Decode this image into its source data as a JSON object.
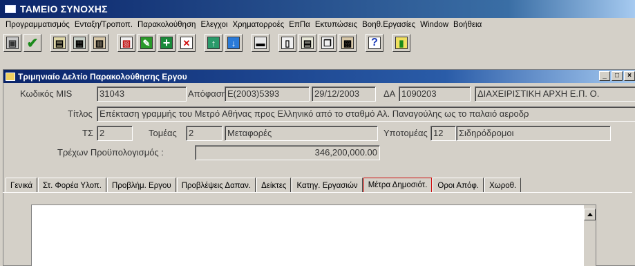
{
  "app": {
    "title": "ΤΑΜΕΙΟ ΣΥΝΟΧΗΣ"
  },
  "menu": [
    "Προγραμματισμός",
    "Ενταξη/Τροποπ.",
    "Παρακολούθηση",
    "Ελεγχοι",
    "Χρηματορροές",
    "ΕπΠα",
    "Εκτυπώσεις",
    "Βοηθ.Εργασίες",
    "Window",
    "Βοήθεια"
  ],
  "toolbar": {
    "buttons": [
      {
        "name": "save-icon",
        "glyph": "▣"
      },
      {
        "name": "check-icon",
        "glyph": "✔"
      },
      {
        "name": "dialog-icon",
        "glyph": "▤"
      },
      {
        "name": "grid-icon",
        "glyph": "▦"
      },
      {
        "name": "document-icon",
        "glyph": "▥"
      },
      {
        "name": "chart-icon",
        "glyph": "▧"
      },
      {
        "name": "edit-icon",
        "glyph": "✎"
      },
      {
        "name": "add-row-icon",
        "glyph": "+"
      },
      {
        "name": "delete-icon",
        "glyph": "✕"
      },
      {
        "name": "arrow-up-icon",
        "glyph": "↑"
      },
      {
        "name": "arrow-down-icon",
        "glyph": "↓"
      },
      {
        "name": "print-icon",
        "glyph": "▬"
      },
      {
        "name": "columns-icon",
        "glyph": "▯"
      },
      {
        "name": "report-icon",
        "glyph": "▤"
      },
      {
        "name": "copy-icon",
        "glyph": "❐"
      },
      {
        "name": "paste-icon",
        "glyph": "▩"
      },
      {
        "name": "help-icon",
        "glyph": "?"
      },
      {
        "name": "exit-icon",
        "glyph": "▮"
      }
    ]
  },
  "child": {
    "title": "Τριμηνιαίο Δελτίο Παρακολούθησης Εργου",
    "win_min": "_",
    "win_restore": "□",
    "win_close": "×",
    "labels": {
      "mis": "Κωδικός MIS",
      "decision": "Απόφαση",
      "da": "ΔΑ",
      "title": "Τίτλος",
      "ts": "ΤΣ",
      "sector": "Τομέας",
      "subsector": "Υποτομέας",
      "budget": "Τρέχων Προϋπολογισμός :"
    },
    "values": {
      "mis": "31043",
      "decision": "E(2003)5393",
      "decision_date": "29/12/2003",
      "da_code": "1090203",
      "authority": "ΔΙΑΧΕΙΡΙΣΤΙΚΗ ΑΡΧΗ Ε.Π. Ο.",
      "title": "Επέκταση γραμμής του Μετρό Αθήνας προς Ελληνικό από το σταθμό Αλ. Παναγούλης ως το παλαιό αεροδρ",
      "ts": "2",
      "sector_code": "2",
      "sector_name": "Μεταφορές",
      "subsector_code": "12",
      "subsector_name": "Σιδηρόδρομοι",
      "budget": "346,200,000.00"
    }
  },
  "tabs": [
    "Γενικά",
    "Στ. Φορέα Υλοπ.",
    "Προβλήμ. Εργου",
    "Προβλέψεις Δαπαν.",
    "Δείκτες",
    "Κατηγ. Εργασιών",
    "Μέτρα Δημοσιότ.",
    "Οροι Απόφ.",
    "Χωροθ."
  ],
  "active_tab": "Μέτρα Δημοσιότ."
}
